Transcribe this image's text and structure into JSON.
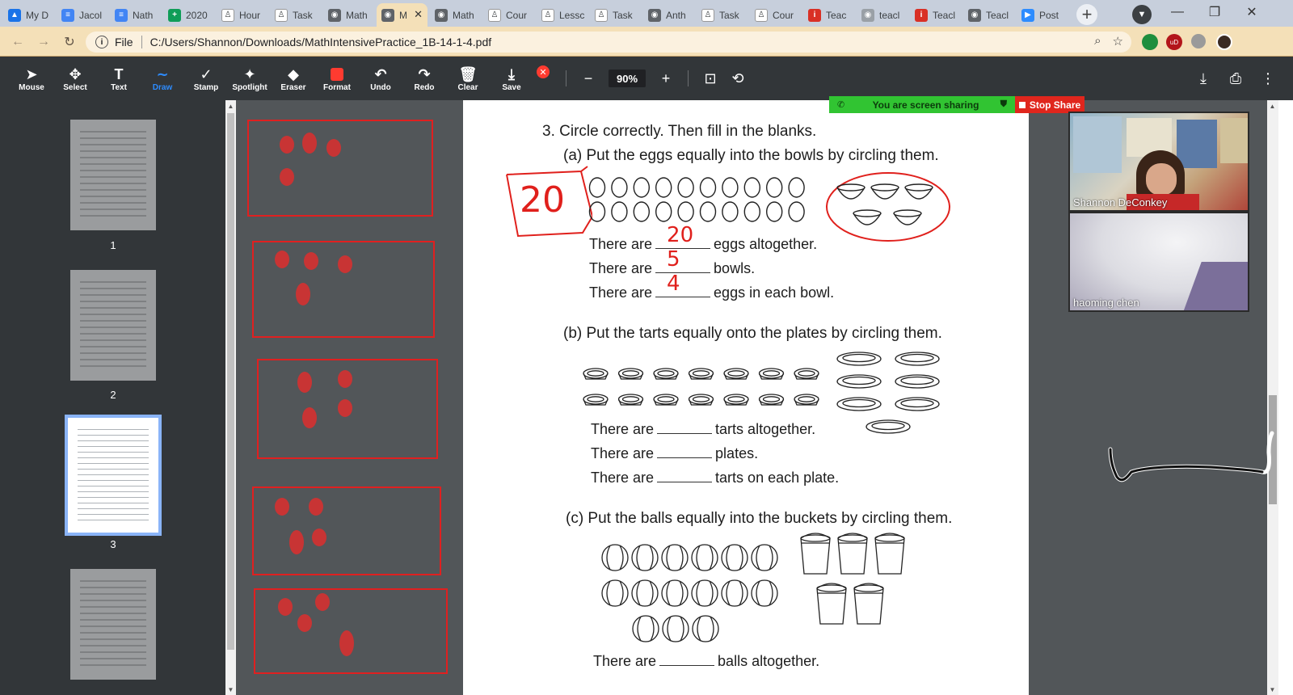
{
  "browser": {
    "tabs": [
      {
        "label": "My D",
        "color": "#1a73e8",
        "glyph": "▲"
      },
      {
        "label": "Jacol",
        "color": "#4285f4",
        "glyph": "≡"
      },
      {
        "label": "Nath",
        "color": "#4285f4",
        "glyph": "≡"
      },
      {
        "label": "2020",
        "color": "#0f9d58",
        "glyph": "+"
      },
      {
        "label": "Hour",
        "color": "#ffffff",
        "glyph": "♙"
      },
      {
        "label": "Task",
        "color": "#ffffff",
        "glyph": "♙"
      },
      {
        "label": "Math",
        "color": "#5f6368",
        "glyph": "◉"
      },
      {
        "label": "M",
        "color": "#5f6368",
        "glyph": "◉",
        "active": true
      },
      {
        "label": "Math",
        "color": "#5f6368",
        "glyph": "◉"
      },
      {
        "label": "Cour",
        "color": "#ffffff",
        "glyph": "♙"
      },
      {
        "label": "Lessc",
        "color": "#ffffff",
        "glyph": "♙"
      },
      {
        "label": "Task",
        "color": "#ffffff",
        "glyph": "♙"
      },
      {
        "label": "Anth",
        "color": "#5f6368",
        "glyph": "◉"
      },
      {
        "label": "Task",
        "color": "#ffffff",
        "glyph": "♙"
      },
      {
        "label": "Cour",
        "color": "#ffffff",
        "glyph": "♙"
      },
      {
        "label": "Teac",
        "color": "#d93025",
        "glyph": "i"
      },
      {
        "label": "teacl",
        "color": "#9aa0a6",
        "glyph": "◉"
      },
      {
        "label": "Teacl",
        "color": "#d93025",
        "glyph": "i"
      },
      {
        "label": "Teacl",
        "color": "#5f6368",
        "glyph": "◉"
      },
      {
        "label": "Post",
        "color": "#2d8cff",
        "glyph": "▶"
      }
    ],
    "active_tab_close": "✕",
    "newtab": "+",
    "url_scheme": "File",
    "url": "C:/Users/Shannon/Downloads/MathIntensivePractice_1B-14-1-4.pdf"
  },
  "toolbar": {
    "tools": [
      {
        "label": "Mouse",
        "icon": "➤"
      },
      {
        "label": "Select",
        "icon": "✥"
      },
      {
        "label": "Text",
        "icon": "T"
      },
      {
        "label": "Draw",
        "icon": "∼",
        "active": true
      },
      {
        "label": "Stamp",
        "icon": "✓"
      },
      {
        "label": "Spotlight",
        "icon": "✦"
      },
      {
        "label": "Eraser",
        "icon": "◆"
      },
      {
        "label": "Format",
        "icon": ""
      },
      {
        "label": "Undo",
        "icon": "↶"
      },
      {
        "label": "Redo",
        "icon": "↷"
      },
      {
        "label": "Clear",
        "icon": "🗑"
      },
      {
        "label": "Save",
        "icon": "⤓"
      }
    ],
    "zoom": "90%",
    "zoom_minus": "−",
    "zoom_plus": "+"
  },
  "thumbnails": [
    "1",
    "2",
    "3"
  ],
  "share": {
    "status": "You are screen sharing",
    "stop": "Stop Share"
  },
  "participants": [
    {
      "name": "Shannon DeConkey"
    },
    {
      "name": "haoming chen"
    }
  ],
  "page": {
    "q3": "3.  Circle correctly. Then fill in the blanks.",
    "qa": "(a)  Put the eggs equally into the bowls by circling them.",
    "a_lines": [
      {
        "pre": "There are",
        "post": "eggs altogether.",
        "handwritten": "20"
      },
      {
        "pre": "There are",
        "post": "bowls.",
        "handwritten": "5"
      },
      {
        "pre": "There are",
        "post": "eggs in each bowl.",
        "handwritten": "4"
      }
    ],
    "a_circled": "20",
    "qb": "(b)  Put the tarts equally onto the plates by circling them.",
    "b_lines": [
      {
        "pre": "There are",
        "post": "tarts altogether."
      },
      {
        "pre": "There are",
        "post": "plates."
      },
      {
        "pre": "There are",
        "post": "tarts on each plate."
      }
    ],
    "qc": "(c)  Put the balls equally into the buckets by circling them.",
    "c_lines": [
      {
        "pre": "There are",
        "post": "balls altogether."
      }
    ]
  }
}
